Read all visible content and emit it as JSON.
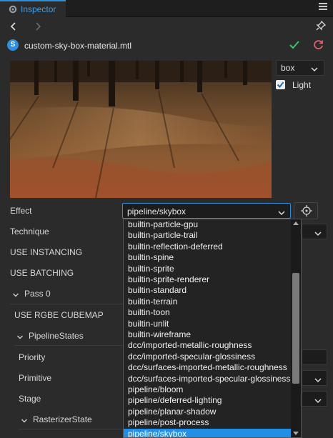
{
  "panel": {
    "tab_label": "Inspector"
  },
  "file": {
    "name": "custom-sky-box-material.mtl",
    "icon_letter": "S"
  },
  "preview": {
    "shape_value": "box",
    "light_label": "Light",
    "light_checked": true
  },
  "effect": {
    "label": "Effect",
    "value": "pipeline/skybox"
  },
  "properties": {
    "technique": "Technique",
    "use_instancing": "USE INSTANCING",
    "use_batching": "USE BATCHING",
    "pass": "Pass 0",
    "use_rgbe_cubemap": "USE RGBE CUBEMAP",
    "pipeline_states": "PipelineStates",
    "priority": "Priority",
    "primitive": "Primitive",
    "stage": "Stage",
    "rasterizer_state": "RasterizerState"
  },
  "dropdown": {
    "items": [
      "builtin-particle-gpu",
      "builtin-particle-trail",
      "builtin-reflection-deferred",
      "builtin-spine",
      "builtin-sprite",
      "builtin-sprite-renderer",
      "builtin-standard",
      "builtin-terrain",
      "builtin-toon",
      "builtin-unlit",
      "builtin-wireframe",
      "dcc/imported-metallic-roughness",
      "dcc/imported-specular-glossiness",
      "dcc/surfaces-imported-metallic-roughness",
      "dcc/surfaces-imported-specular-glossiness",
      "pipeline/bloom",
      "pipeline/deferred-lighting",
      "pipeline/planar-shadow",
      "pipeline/post-process",
      "pipeline/skybox"
    ],
    "selected": "pipeline/skybox"
  },
  "colors": {
    "accent": "#2f8fd8",
    "apply": "#3fbf6f",
    "revert": "#e0606a",
    "selection": "#1f8fe8"
  }
}
